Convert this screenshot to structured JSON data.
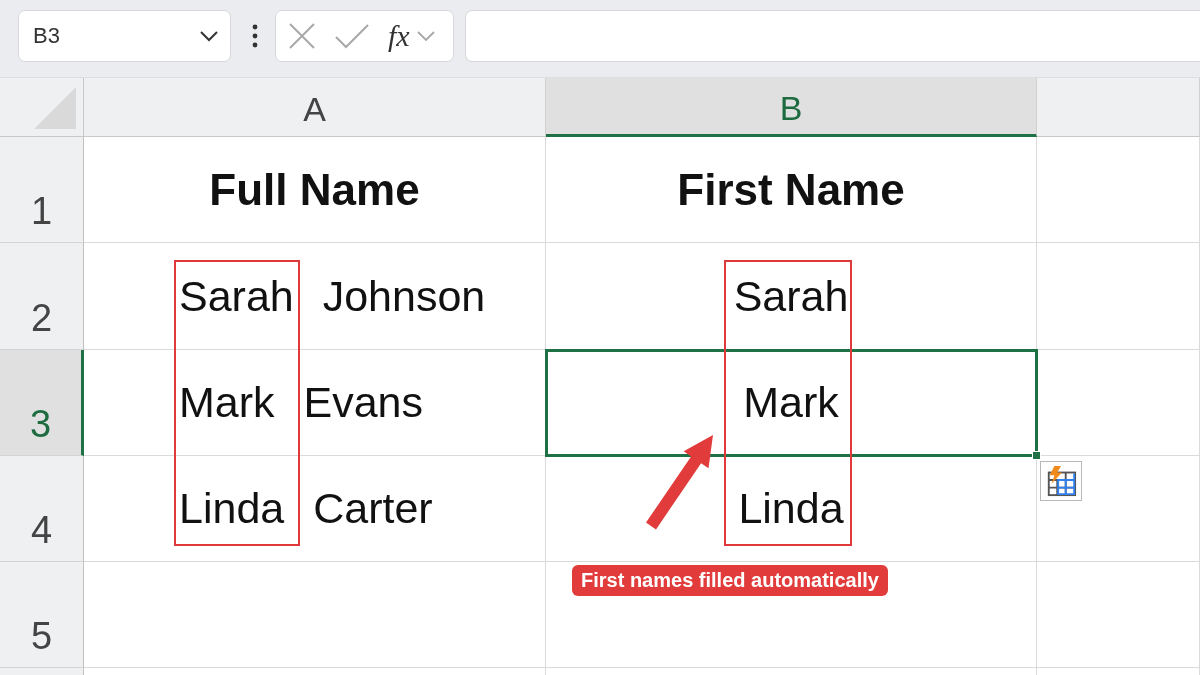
{
  "name_box": {
    "value": "B3"
  },
  "formula_bar": {
    "function_label": "fx"
  },
  "columns": [
    {
      "label": "A",
      "selected": false,
      "framed": true
    },
    {
      "label": "B",
      "selected": true,
      "framed": true
    }
  ],
  "rows": [
    {
      "number": "1",
      "selected": false,
      "cells": [
        {
          "kind": "header",
          "text": "Full Name",
          "selected": false
        },
        {
          "kind": "header",
          "text": "First Name",
          "selected": false
        }
      ]
    },
    {
      "number": "2",
      "selected": false,
      "cells": [
        {
          "kind": "data",
          "text": "Sarah Johnson",
          "selected": false
        },
        {
          "kind": "data",
          "text": "Sarah",
          "selected": false
        }
      ]
    },
    {
      "number": "3",
      "selected": true,
      "cells": [
        {
          "kind": "data",
          "text": "Mark Evans",
          "selected": false
        },
        {
          "kind": "data",
          "text": "Mark",
          "selected": true
        }
      ]
    },
    {
      "number": "4",
      "selected": false,
      "cells": [
        {
          "kind": "data",
          "text": "Linda Carter",
          "selected": false
        },
        {
          "kind": "data",
          "text": "Linda",
          "selected": false
        }
      ]
    },
    {
      "number": "5",
      "selected": false
    }
  ],
  "callout": {
    "label": "First names filled automatically",
    "arrow": true
  }
}
